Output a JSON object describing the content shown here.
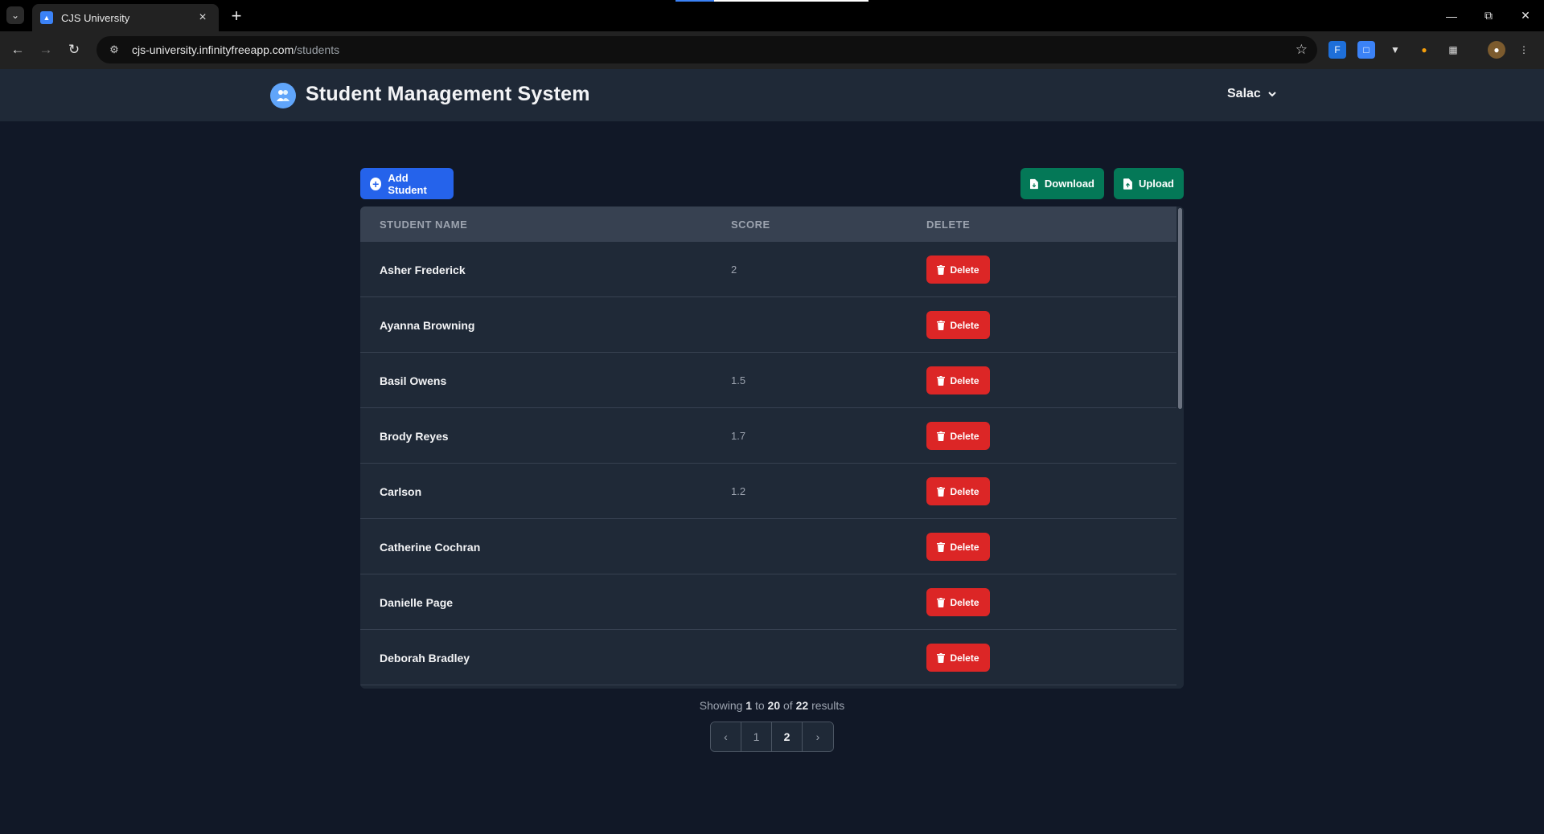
{
  "browser": {
    "tab_title": "CJS University",
    "tab_favicon": "CJS",
    "url_host": "cjs-university.infinityfreeapp.com",
    "url_path": "/students"
  },
  "app": {
    "title": "Student Management System",
    "user_name": "Salac"
  },
  "actions": {
    "add_label": "Add Student",
    "download_label": "Download",
    "upload_label": "Upload"
  },
  "table": {
    "headers": [
      "STUDENT NAME",
      "SCORE",
      "DELETE"
    ],
    "delete_label": "Delete",
    "rows": [
      {
        "name": "Asher Frederick",
        "score": "2"
      },
      {
        "name": "Ayanna Browning",
        "score": ""
      },
      {
        "name": "Basil Owens",
        "score": "1.5"
      },
      {
        "name": "Brody Reyes",
        "score": "1.7"
      },
      {
        "name": "Carlson",
        "score": "1.2"
      },
      {
        "name": "Catherine Cochran",
        "score": ""
      },
      {
        "name": "Danielle Page",
        "score": ""
      },
      {
        "name": "Deborah Bradley",
        "score": ""
      }
    ]
  },
  "pagination": {
    "showing": "Showing",
    "from": "1",
    "to_word": "to",
    "to": "20",
    "of_word": "of",
    "total": "22",
    "results_word": "results",
    "pages": [
      "1",
      "2"
    ],
    "current_page": "2"
  },
  "colors": {
    "primary": "#2563eb",
    "success": "#047857",
    "danger": "#dc2626",
    "background": "#111827",
    "surface": "#1f2937"
  }
}
